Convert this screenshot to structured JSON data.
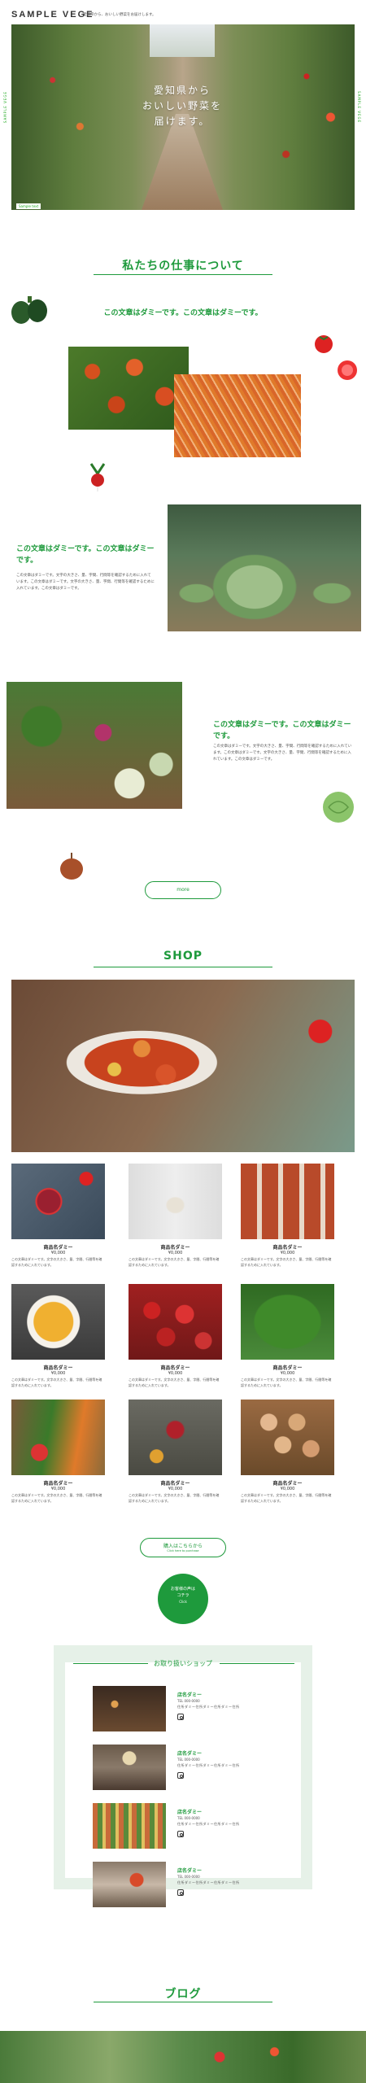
{
  "header": {
    "logo": "SAMPLE VEGE",
    "tagline": "愛知県から、おいしい野菜をお届けします。"
  },
  "hero": {
    "line1": "愛知県から",
    "line2": "おいしい野菜を",
    "line3": "届けます。",
    "badge": "Sample text",
    "side_left": "SAMPLE VEGE",
    "side_right": "SAMPLE VEGE"
  },
  "about": {
    "title": "私たちの仕事について",
    "lead": "この文章はダミーです。この文章はダミーです。",
    "block1_heading": "この文章はダミーです。この文章はダミーです。",
    "block1_text": "この文章はダミーです。文字の大きさ、量、字間、行間等を確認するために入れています。この文章はダミーです。文字の大きさ、量、字間、行間等を確認するために入れています。この文章はダミーです。",
    "block2_heading": "この文章はダミーです。この文章はダミーです。",
    "block2_text": "この文章はダミーです。文字の大きさ、量、字間、行間等を確認するために入れています。この文章はダミーです。文字の大きさ、量、字間、行間等を確認するために入れています。この文章はダミーです。",
    "more_button": "more"
  },
  "shop": {
    "title": "SHOP",
    "products": [
      {
        "name": "商品名ダミー",
        "price": "¥0,000",
        "desc": "この文章はダミーです。文字の大きさ、量、字間、行間等を確認するために入れています。"
      },
      {
        "name": "商品名ダミー",
        "price": "¥0,000",
        "desc": "この文章はダミーです。文字の大きさ、量、字間、行間等を確認するために入れています。"
      },
      {
        "name": "商品名ダミー",
        "price": "¥0,000",
        "desc": "この文章はダミーです。文字の大きさ、量、字間、行間等を確認するために入れています。"
      },
      {
        "name": "商品名ダミー",
        "price": "¥0,000",
        "desc": "この文章はダミーです。文字の大きさ、量、字間、行間等を確認するために入れています。"
      },
      {
        "name": "商品名ダミー",
        "price": "¥0,000",
        "desc": "この文章はダミーです。文字の大きさ、量、字間、行間等を確認するために入れています。"
      },
      {
        "name": "商品名ダミー",
        "price": "¥0,000",
        "desc": "この文章はダミーです。文字の大きさ、量、字間、行間等を確認するために入れています。"
      },
      {
        "name": "商品名ダミー",
        "price": "¥0,000",
        "desc": "この文章はダミーです。文字の大きさ、量、字間、行間等を確認するために入れています。"
      },
      {
        "name": "商品名ダミー",
        "price": "¥0,000",
        "desc": "この文章はダミーです。文字の大きさ、量、字間、行間等を確認するために入れています。"
      },
      {
        "name": "商品名ダミー",
        "price": "¥0,000",
        "desc": "この文章はダミーです。文字の大きさ、量、字間、行間等を確認するために入れています。"
      }
    ],
    "buy_button": "購入はこちらから",
    "buy_sub": "Click here to purchase",
    "circle_line1": "お客様の声は",
    "circle_line2": "コチラ",
    "circle_line3": "Click"
  },
  "stores": {
    "title": "お取り扱いショップ",
    "items": [
      {
        "name": "店名ダミー",
        "tel": "TEL 000-0000",
        "addr": "住所ダミー住所ダミー住所ダミー住所"
      },
      {
        "name": "店名ダミー",
        "tel": "TEL 000-0000",
        "addr": "住所ダミー住所ダミー住所ダミー住所"
      },
      {
        "name": "店名ダミー",
        "tel": "TEL 000-0000",
        "addr": "住所ダミー住所ダミー住所ダミー住所"
      },
      {
        "name": "店名ダミー",
        "tel": "TEL 000-0000",
        "addr": "住所ダミー住所ダミー住所ダミー住所"
      }
    ]
  },
  "blog": {
    "title": "ブログ"
  },
  "colors": {
    "accent": "#1e9a3c",
    "panel": "#e6f1e8"
  }
}
